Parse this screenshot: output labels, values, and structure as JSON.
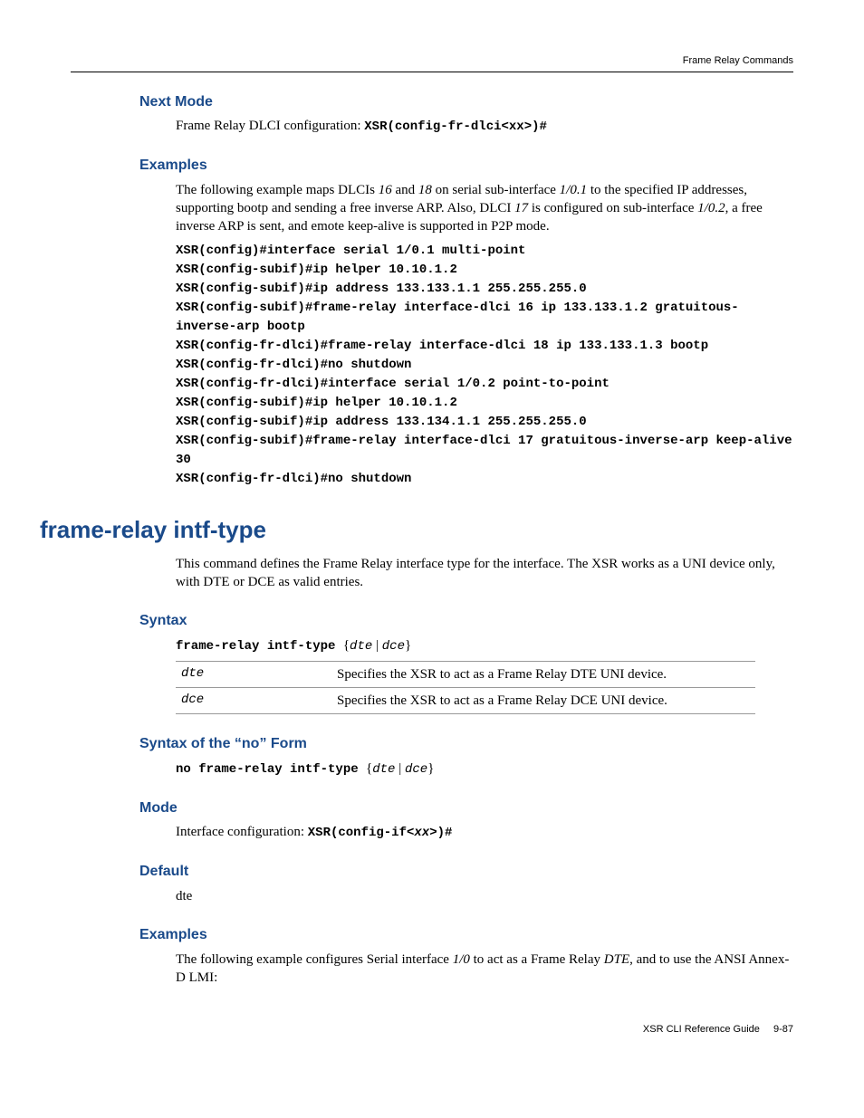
{
  "running_header": "Frame Relay Commands",
  "section1": {
    "h_nextmode": "Next Mode",
    "nextmode_text": "Frame Relay DLCI configuration: ",
    "nextmode_code": "XSR(config-fr-dlci<xx>)#",
    "h_examples": "Examples",
    "examples_intro": "The following example maps DLCIs 16 and 18 on serial sub-interface 1/0.1 to the specified IP addresses, supporting bootp and sending a free inverse ARP. Also, DLCI 17 is configured on sub-interface 1/0.2, a free inverse ARP is sent, and emote keep-alive is supported in P2P mode.",
    "code": "XSR(config)#interface serial 1/0.1 multi-point\nXSR(config-subif)#ip helper 10.10.1.2\nXSR(config-subif)#ip address 133.133.1.1 255.255.255.0\nXSR(config-subif)#frame-relay interface-dlci 16 ip 133.133.1.2 gratuitous-inverse-arp bootp\nXSR(config-fr-dlci)#frame-relay interface-dlci 18 ip 133.133.1.3 bootp\nXSR(config-fr-dlci)#no shutdown\nXSR(config-fr-dlci)#interface serial 1/0.2 point-to-point\nXSR(config-subif)#ip helper 10.10.1.2\nXSR(config-subif)#ip address 133.134.1.1 255.255.255.0\nXSR(config-subif)#frame-relay interface-dlci 17 gratuitous-inverse-arp keep-alive 30\nXSR(config-fr-dlci)#no shutdown"
  },
  "section2": {
    "h_cmd": "frame-relay intf-type",
    "intro": "This command defines the Frame Relay interface type for the interface. The XSR works as a UNI device only, with DTE or DCE as valid entries.",
    "h_syntax": "Syntax",
    "syntax_cmd": "frame-relay intf-type ",
    "syntax_brace_open": "{",
    "syntax_opt1": "dte",
    "syntax_pipe": " | ",
    "syntax_opt2": "dce",
    "syntax_brace_close": "}",
    "table": [
      {
        "opt": "dte",
        "desc": "Specifies the XSR to act as a Frame Relay DTE UNI device."
      },
      {
        "opt": "dce",
        "desc": "Specifies the XSR to act as a Frame Relay DCE UNI device."
      }
    ],
    "h_no": "Syntax of the “no” Form",
    "no_cmd": "no frame-relay intf-type ",
    "h_mode": "Mode",
    "mode_text": "Interface configuration: ",
    "mode_code_pre": "XSR(config-if<",
    "mode_code_var": "xx",
    "mode_code_post": ">)#",
    "h_default": "Default",
    "default_text": "dte",
    "h_examples": "Examples",
    "examples_text": "The following example configures Serial interface 1/0 to act as a Frame Relay DTE, and to use the ANSI Annex-D LMI:"
  },
  "footer": {
    "guide": "XSR CLI Reference Guide",
    "page": "9-87"
  }
}
